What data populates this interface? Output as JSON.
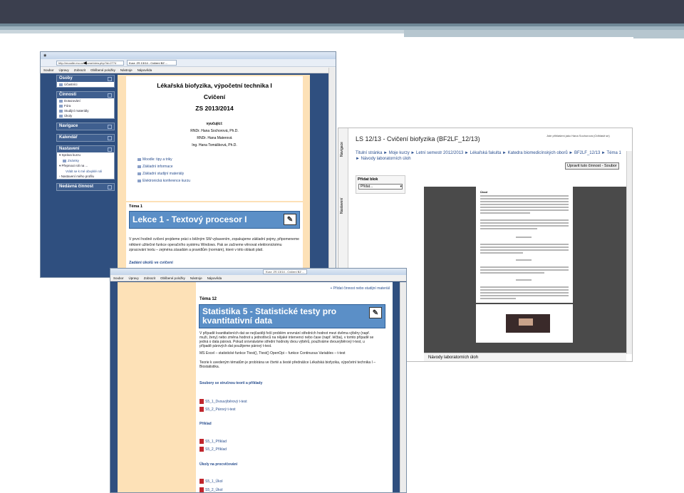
{
  "w1": {
    "tab_title": "Kurz: ZS 13/14 - Cvičení BZ ...",
    "url": "http://moodle.mu.cz/course/view.php?id=2774",
    "menu": [
      "Soubor",
      "Úpravy",
      "Zobrazit",
      "Oblíbené položky",
      "Nástroje",
      "Nápověda"
    ],
    "osoby": {
      "title": "Osoby",
      "items": [
        "Účastníci"
      ]
    },
    "cinnosti": {
      "title": "Činnosti",
      "items": [
        "Dotazování",
        "Fóra",
        "Studijní materiály",
        "Úkoly"
      ]
    },
    "navigace": "Navigace",
    "kalendar": "Kalendář",
    "nastaveni": {
      "title": "Nastavení",
      "sprava": "Správa kurzu",
      "znamky": "Známky",
      "prepnout": "Přepnout roli na ...",
      "vratit": "Vrátit se k mé obvyklé roli",
      "nastaveni_profilu": "Nastavení mého profilu"
    },
    "nedavna": "Nedávná činnost",
    "course": {
      "title": "Lékařská biofyzika, výpočetní technika I",
      "sub": "Cvičení",
      "year": "ZS 2013/2014",
      "teach_label": "vyučující:",
      "teachers": [
        "RNDr. Hana Sochorová, Ph.D.",
        "RNDr. Hana Materová",
        "Ing. Hana Tomášková, Ph.D."
      ]
    },
    "links": [
      "Moodle: tipy a triky",
      "Základní informace",
      "Základní studijní materiály",
      "Elektronická konference kurzu"
    ],
    "tema": "Téma 1",
    "lekce": "Lekce 1 - Textový procesor I",
    "paragraph": "V první hodině cvičení projdeme práci s běžným SW vybavením, zopakujeme základní pojmy, připomeneme některé užitečné funkce operačního systému Windows. Pak se začneme věnovat elektronickému zpracování textu – zejména zásadám a pravidlům (normám), které v této oblasti platí.",
    "next": "Zadání úkolů ve cvičení"
  },
  "w2": {
    "tab_title": "Kurz: ZS 13/14 - Cvičení BZ ...",
    "menu": [
      "Soubor",
      "Úpravy",
      "Zobrazit",
      "Oblíbené položky",
      "Nástroje",
      "Nápověda"
    ],
    "add": "+ Přidat činnost nebo studijní materiál",
    "tema": "Téma 12",
    "lekce": "Statistika 5 - Statistické testy pro kvantitativní data",
    "p1": "V případě kvantitativních dat se nejčastěji řeší problém srovnání středních hodnot mezi dvěma výběry (např. muži, ženy) nebo změna hodnot u jednotlivců na nějaké intervenci nebo čase (např. léčba), v tomto případě se jedná o data párová. Pokud srovnáváme střední hodnoty dvou výběrů, používáme dvouvýběrový t-test, u případě párových dat použijeme párový t-test.",
    "p2": "MS Excel – statistické funkce Ttest(), Ttest() OpenOpi – funkce Continuous Variables – t-test",
    "p3": "Teorie k uvedeným tématům je probírána ve čtvrté a šesté přednášce Lékařská biofyzika, výpočetní technika I – Biostatistika.",
    "s1": "Soubory se stručnou teorií a příklady",
    "s1_items": [
      "S5_1_Dvouvýběrový t-test",
      "S5_2_Párový t-test"
    ],
    "s2": "Příklad",
    "s2_items": [
      "S5_1_Příklad",
      "S5_2_Příklad"
    ],
    "s3": "Úkoly na procvičování",
    "s3_items": [
      "S5_1_Úkol",
      "S5_2_Úkol"
    ]
  },
  "w3": {
    "title": "LS 12/13 - Cvičení biofyzika (BF2LF_12/13)",
    "login": "Jste přihlášeni jako Hana Sochorová (Odhlásit se)",
    "nav_label": "Navigace",
    "nastaveni_label": "Nastavení",
    "breadcrumb": "Titulní stránka ► Moje kurzy ► Letní semestr 2012/2013 ► Lékařská fakulta ► Katedra biomedicínských oborů ► BF2LF_12/13 ► Téma 1 ► Návody laboratorních úloh",
    "button": "Upravit tuto činnost - Soubor",
    "pridat": "Přidat blok",
    "select": "Přidat...",
    "doc_head": "Úvod",
    "footer": "Návody laboratorních úloh"
  }
}
